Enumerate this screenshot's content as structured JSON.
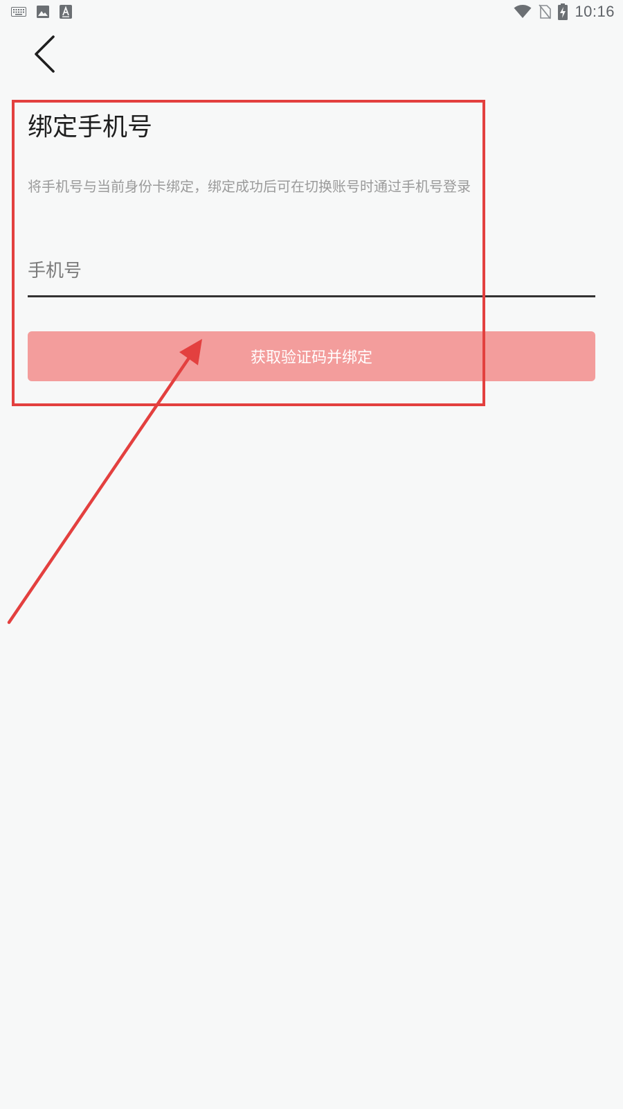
{
  "status_bar": {
    "time": "10:16",
    "left_icons": [
      "keyboard-icon",
      "image-icon",
      "font-a-icon"
    ],
    "right_icons": [
      "wifi-icon",
      "no-sim-icon",
      "battery-charging-icon"
    ]
  },
  "nav": {
    "back_icon": "chevron-left-icon"
  },
  "page": {
    "title": "绑定手机号",
    "description": "将手机号与当前身份卡绑定，绑定成功后可在切换账号时通过手机号登录"
  },
  "form": {
    "phone_placeholder": "手机号",
    "phone_value": "",
    "submit_label": "获取验证码并绑定"
  },
  "colors": {
    "background": "#f7f8f8",
    "button": "#f39d9c",
    "annotation": "#e3403f"
  }
}
